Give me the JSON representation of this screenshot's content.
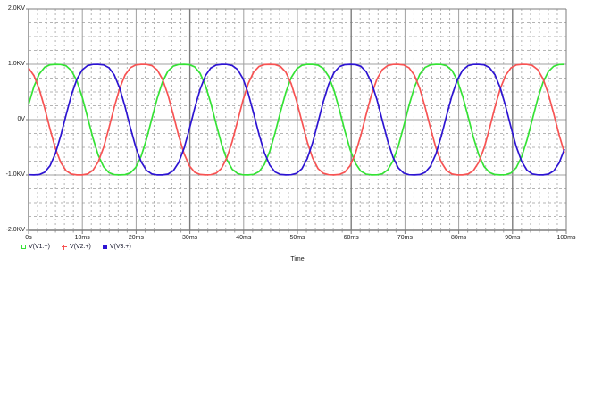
{
  "window": {
    "background": "#ffffff"
  },
  "chart_data": {
    "type": "line",
    "title": "",
    "xlabel": "Time",
    "ylabel": "",
    "x_ticks": [
      "0s",
      "10ms",
      "20ms",
      "30ms",
      "40ms",
      "50ms",
      "60ms",
      "70ms",
      "80ms",
      "90ms",
      "100ms"
    ],
    "y_ticks": [
      "2.0KV",
      "1.0KV",
      "0V",
      "-1.0KV",
      "-2.0KV"
    ],
    "xlim_ms": [
      0,
      100
    ],
    "ylim_v": [
      -2000,
      2000
    ],
    "grid": {
      "on": true,
      "style": "major-solid-minor-dashed",
      "x_minor_per_major": 6,
      "y_minor_per_major": 4,
      "major_color": "#a0a0a0",
      "strong_color": "#7d7d7d",
      "minor_color": "#b4b4b4",
      "strong_every_nth_major": 3
    },
    "legend_position": "bottom-left",
    "waveform_model": "v = amplitude_v * ( sin(2*pi*t/period_ms + phase_deg) + flat_top_3rd_harmonic * sin(3*(2*pi*t/period_ms + phase_deg)) )",
    "series": [
      {
        "name": "V(V1:+)",
        "color": "#35e235",
        "marker": "square-outline",
        "amplitude_v": 1110,
        "period_ms": 23.6,
        "phase_deg": 11,
        "flat_top_3rd_harmonic": 0.1,
        "first_peak_ms": 5.2
      },
      {
        "name": "V(V2:+)",
        "color": "#f75353",
        "marker": "plus",
        "amplitude_v": 1110,
        "period_ms": 23.6,
        "phase_deg": 126,
        "flat_top_3rd_harmonic": 0.1,
        "first_peak_ms": 21.3
      },
      {
        "name": "V(V3:+)",
        "color": "#2d14d2",
        "marker": "square-filled",
        "amplitude_v": 1110,
        "period_ms": 23.6,
        "phase_deg": -103,
        "flat_top_3rd_harmonic": 0.1,
        "first_peak_ms": 12.6
      }
    ]
  }
}
